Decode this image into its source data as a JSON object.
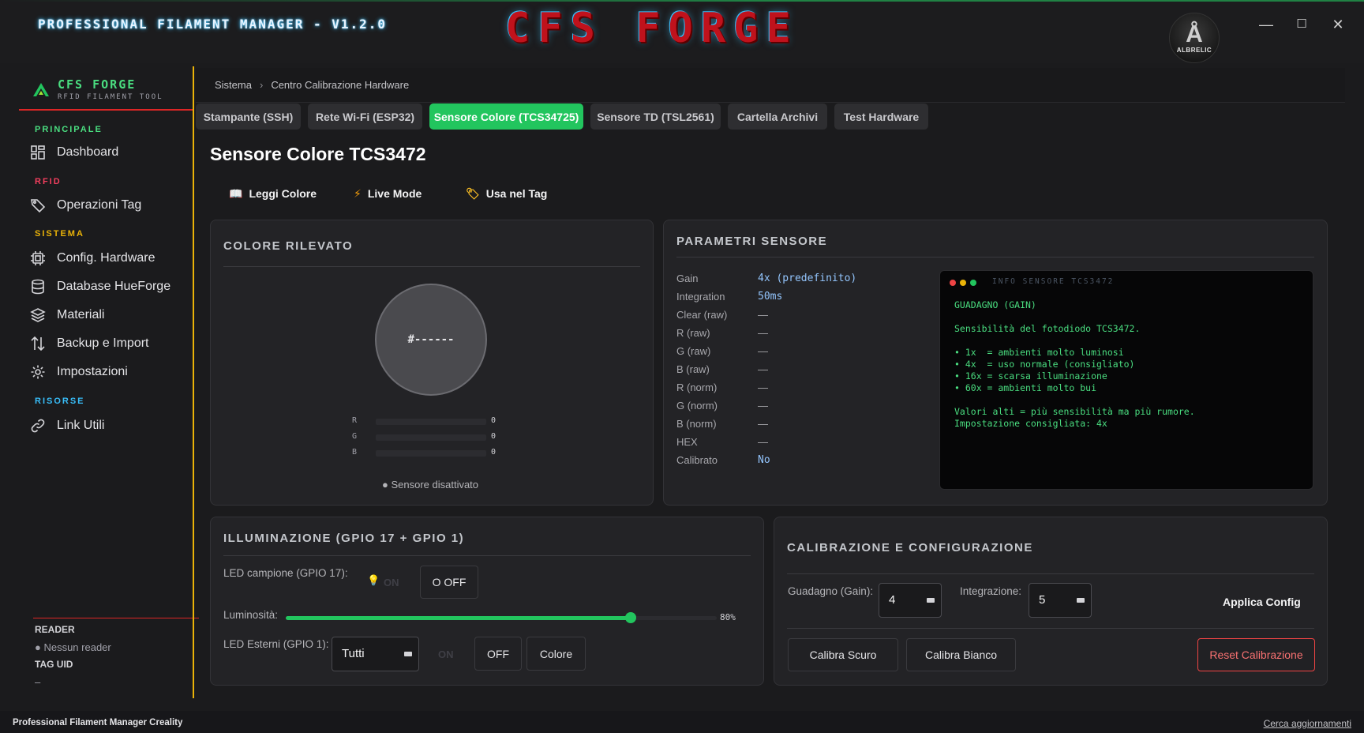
{
  "window": {
    "app_title": "PROFESSIONAL FILAMENT MANAGER - V1.2.0",
    "logo_text": "CFS FORGE",
    "avatar_text": "ALBRELIC",
    "controls": {
      "minimize": "—",
      "maximize": "☐",
      "close": "✕"
    }
  },
  "sidebar": {
    "brand_name": "CFS FORGE",
    "brand_sub": "RFID FILAMENT TOOL",
    "sections": {
      "principale": "PRINCIPALE",
      "rfid": "RFID",
      "sistema": "SISTEMA",
      "risorse": "RISORSE"
    },
    "items": [
      {
        "label": "Dashboard",
        "icon": "dashboard-icon"
      },
      {
        "label": "Operazioni Tag",
        "icon": "tag-icon"
      },
      {
        "label": "Config. Hardware",
        "icon": "chip-icon"
      },
      {
        "label": "Database HueForge",
        "icon": "database-icon"
      },
      {
        "label": "Materiali",
        "icon": "layers-icon"
      },
      {
        "label": "Backup e Import",
        "icon": "transfer-icon"
      },
      {
        "label": "Impostazioni",
        "icon": "gear-icon"
      },
      {
        "label": "Link Utili",
        "icon": "link-icon"
      }
    ],
    "reader_label": "READER",
    "reader_value": "● Nessun reader",
    "tag_uid_label": "TAG UID",
    "tag_uid_value": "–"
  },
  "breadcrumb": {
    "root": "Sistema",
    "sep": "›",
    "current": "Centro Calibrazione Hardware"
  },
  "tabs": [
    {
      "label": "Stampante (SSH)",
      "active": false
    },
    {
      "label": "Rete Wi-Fi (ESP32)",
      "active": false
    },
    {
      "label": "Sensore Colore (TCS34725)",
      "active": true
    },
    {
      "label": "Sensore TD (TSL2561)",
      "active": false
    },
    {
      "label": "Cartella Archivi",
      "active": false
    },
    {
      "label": "Test Hardware",
      "active": false
    }
  ],
  "page_title": "Sensore Colore TCS3472",
  "actions": {
    "read_color": "Leggi Colore",
    "live_mode": "Live Mode",
    "use_in_tag": "Usa nel Tag"
  },
  "detected": {
    "title": "COLORE RILEVATO",
    "hex": "#------",
    "rgb": [
      {
        "label": "R",
        "value": "0"
      },
      {
        "label": "G",
        "value": "0"
      },
      {
        "label": "B",
        "value": "0"
      }
    ],
    "status": "● Sensore disattivato"
  },
  "params": {
    "title": "PARAMETRI SENSORE",
    "rows": [
      {
        "key": "Gain",
        "value": "4x (predefinito)",
        "highlight": true
      },
      {
        "key": "Integration",
        "value": "50ms",
        "highlight": true
      },
      {
        "key": "Clear (raw)",
        "value": "—",
        "highlight": false
      },
      {
        "key": "R (raw)",
        "value": "—",
        "highlight": false
      },
      {
        "key": "G (raw)",
        "value": "—",
        "highlight": false
      },
      {
        "key": "B (raw)",
        "value": "—",
        "highlight": false
      },
      {
        "key": "R (norm)",
        "value": "—",
        "highlight": false
      },
      {
        "key": "G (norm)",
        "value": "—",
        "highlight": false
      },
      {
        "key": "B (norm)",
        "value": "—",
        "highlight": false
      },
      {
        "key": "HEX",
        "value": "—",
        "highlight": false
      },
      {
        "key": "Calibrato",
        "value": "No",
        "highlight": true
      }
    ]
  },
  "terminal": {
    "header": "INFO SENSORE TCS3472",
    "lines": [
      "GUADAGNO (GAIN)",
      "",
      "Sensibilità del fotodiodo TCS3472.",
      "",
      "• 1x  = ambienti molto luminosi",
      "• 4x  = uso normale (consigliato)",
      "• 16x = scarsa illuminazione",
      "• 60x = ambienti molto bui",
      "",
      "Valori alti = più sensibilità ma più rumore.",
      "Impostazione consigliata: 4x"
    ]
  },
  "lighting": {
    "title": "ILLUMINAZIONE (GPIO 17 + GPIO 1)",
    "led_sample_label": "LED campione (GPIO 17):",
    "on_label": "ON",
    "off_label": "O OFF",
    "brightness_label": "Luminosità:",
    "brightness_value": 80,
    "brightness_text": "80%",
    "led_ext_label": "LED Esterni (GPIO 1):",
    "led_ext_selected": "Tutti",
    "ext_on": "ON",
    "ext_off": "OFF",
    "ext_color": "Colore"
  },
  "calibration": {
    "title": "CALIBRAZIONE E CONFIGURAZIONE",
    "gain_label": "Guadagno (Gain):",
    "gain_value": "4",
    "integration_label": "Integrazione:",
    "integration_value": "5",
    "apply": "Applica Config",
    "dark": "Calibra Scuro",
    "white": "Calibra Bianco",
    "reset": "Reset Calibrazione"
  },
  "statusbar": {
    "left": "Professional Filament Manager Creality",
    "right": "Cerca aggiornamenti"
  },
  "colors": {
    "accent_green": "#22c55e",
    "brand_red": "#c0121c",
    "sidebar_accent_yellow": "#eab308",
    "reset_red": "#ef4444",
    "terminal_green": "#4ade80"
  }
}
